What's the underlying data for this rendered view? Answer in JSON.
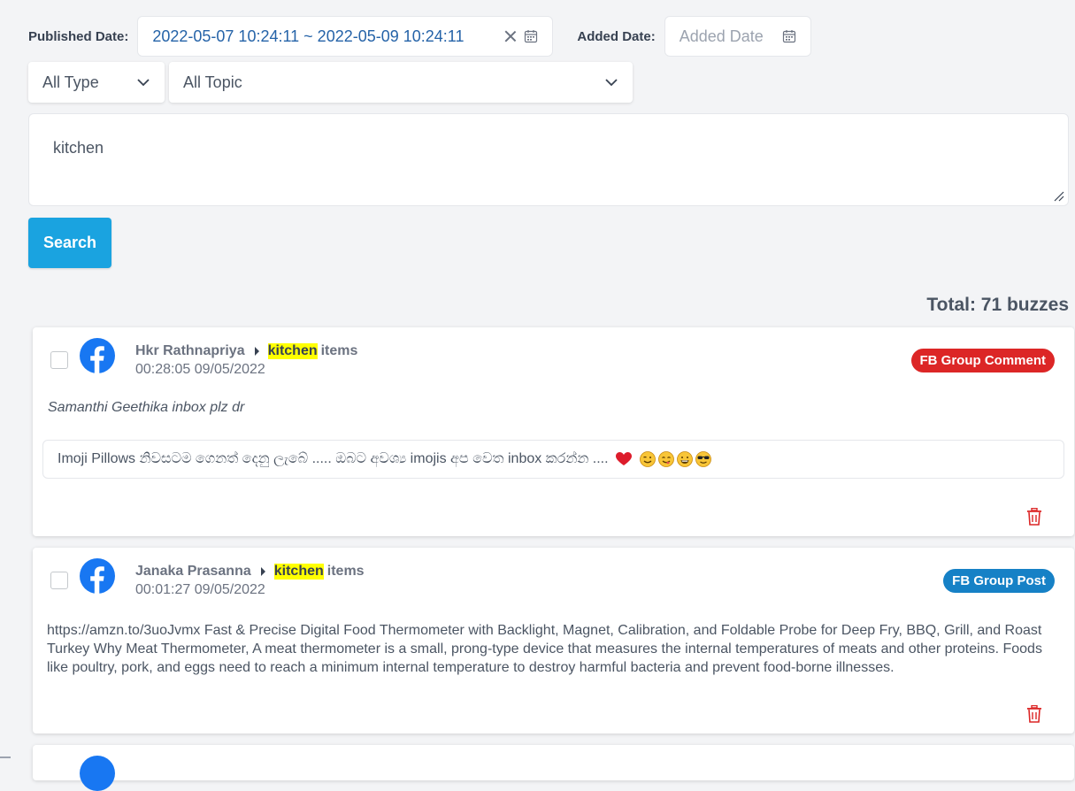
{
  "filters": {
    "published_label": "Published Date:",
    "published_value": "2022-05-07 10:24:11 ~ 2022-05-09 10:24:11",
    "added_label": "Added Date:",
    "added_placeholder": "Added Date",
    "type_select": "All Type",
    "topic_select": "All Topic",
    "keyword": "kitchen",
    "search_label": "Search"
  },
  "total": "Total: 71 buzzes",
  "posts": [
    {
      "author": "Hkr Rathnapriya",
      "group_highlight": "kitchen",
      "group_rest": "items",
      "time": "00:28:05 09/05/2022",
      "badge": "FB Group Comment",
      "comment": "Samanthi Geethika inbox plz dr",
      "parent_text": "Imoji Pillows නිවසටම ගෙනත් දෙනු ලැබේ ..... ඔබට අවශ්‍ය imojis අප වෙත inbox කරන්න ...."
    },
    {
      "author": "Janaka Prasanna",
      "group_highlight": "kitchen",
      "group_rest": "items",
      "time": "00:01:27 09/05/2022",
      "badge": "FB Group Post",
      "text": "https://amzn.to/3uoJvmx Fast & Precise Digital Food Thermometer with Backlight, Magnet, Calibration, and Foldable Probe for Deep Fry, BBQ, Grill, and Roast Turkey Why Meat Thermometer, A meat thermometer is a small, prong-type device that measures the internal temperatures of meats and other proteins. Foods like poultry, pork, and eggs need to reach a minimum internal temperature to destroy harmful bacteria and prevent food-borne illnesses."
    }
  ],
  "colors": {
    "accent": "#1aa3e0",
    "badge_comment": "#dc2626",
    "badge_post": "#1681c6",
    "facebook": "#1877f2",
    "highlight": "#ffff00"
  },
  "icons": {
    "calendar": "calendar-icon",
    "clear": "close-icon",
    "chevron": "chevron-down-icon",
    "facebook": "facebook-icon",
    "trash": "trash-icon"
  }
}
